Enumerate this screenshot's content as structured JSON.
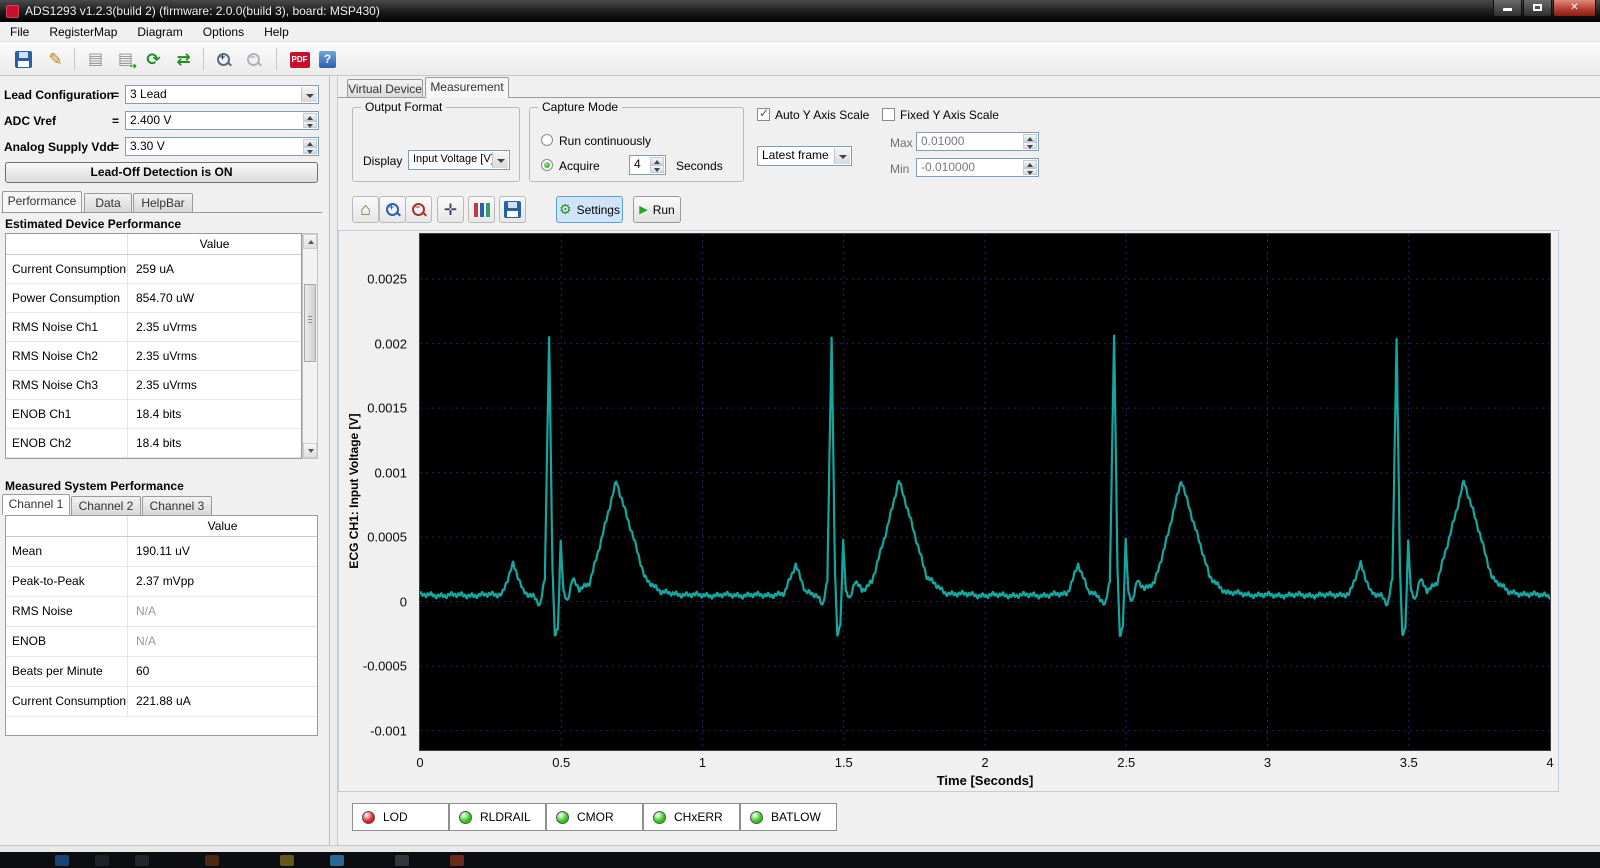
{
  "window": {
    "title": "ADS1293 v1.2.3(build 2) (firmware: 2.0.0(build 3), board: MSP430)",
    "menu": [
      "File",
      "RegisterMap",
      "Diagram",
      "Options",
      "Help"
    ]
  },
  "toolbar": {
    "edit_glyph": "✎",
    "paste_glyph": "▤",
    "import_glyph": "▤",
    "refresh_glyph": "⟳",
    "transfer_glyph": "⇄",
    "pdf_label": "PDF",
    "help_glyph": "?"
  },
  "sidebar": {
    "equals": "=",
    "lead_config_label": "Lead Configuration",
    "lead_config_value": "3 Lead",
    "adc_vref_label": "ADC Vref",
    "adc_vref_value": "2.400 V",
    "vdd_label": "Analog Supply Vdd",
    "vdd_value": "3.30 V",
    "leadoff_button": "Lead-Off Detection is ON",
    "tabs": [
      "Performance",
      "Data",
      "HelpBar"
    ],
    "estimated_title": "Estimated Device Performance",
    "value_header": "Value",
    "estimated_rows": [
      {
        "label": "Current Consumption",
        "value": "259 uA"
      },
      {
        "label": "Power Consumption",
        "value": "854.70 uW"
      },
      {
        "label": "RMS Noise Ch1",
        "value": "2.35 uVrms"
      },
      {
        "label": "RMS Noise Ch2",
        "value": "2.35 uVrms"
      },
      {
        "label": "RMS Noise Ch3",
        "value": "2.35 uVrms"
      },
      {
        "label": "ENOB Ch1",
        "value": "18.4 bits"
      },
      {
        "label": "ENOB Ch2",
        "value": "18.4 bits"
      }
    ],
    "measured_title": "Measured System Performance",
    "channel_tabs": [
      "Channel 1",
      "Channel 2",
      "Channel 3"
    ],
    "measured_rows": [
      {
        "label": "Mean",
        "value": "190.11 uV"
      },
      {
        "label": "Peak-to-Peak",
        "value": "2.37 mVpp"
      },
      {
        "label": "RMS Noise",
        "value": "N/A"
      },
      {
        "label": "ENOB",
        "value": "N/A"
      },
      {
        "label": "Beats per Minute",
        "value": "60"
      },
      {
        "label": "Current Consumption",
        "value": "221.88 uA"
      }
    ]
  },
  "main": {
    "tabs": [
      "Virtual Device",
      "Measurement"
    ],
    "output_format": {
      "title": "Output Format",
      "display_label": "Display",
      "display_value": "Input Voltage [V]"
    },
    "capture_mode": {
      "title": "Capture Mode",
      "run_continuously": "Run continuously",
      "acquire": "Acquire",
      "seconds_value": "4",
      "seconds_label": "Seconds"
    },
    "auto_y": {
      "label": "Auto Y Axis Scale",
      "checked": true,
      "frame_value": "Latest frame"
    },
    "fixed_y": {
      "label": "Fixed Y Axis Scale",
      "checked": false,
      "max_label": "Max",
      "max_value": "0.01000",
      "min_label": "Min",
      "min_value": "-0.010000"
    },
    "plot_buttons": {
      "settings": "Settings",
      "run": "Run"
    },
    "status_leds": [
      {
        "label": "LOD",
        "color": "#e01623"
      },
      {
        "label": "RLDRAIL",
        "color": "#2ec614"
      },
      {
        "label": "CMOR",
        "color": "#2ec614"
      },
      {
        "label": "CHxERR",
        "color": "#2ec614"
      },
      {
        "label": "BATLOW",
        "color": "#2ec614"
      }
    ]
  },
  "chart_data": {
    "type": "line",
    "title": "",
    "series_name": "ECG CH1",
    "xlabel": "Time [Seconds]",
    "ylabel": "ECG CH1: Input Voltage [V]",
    "xlim": [
      0,
      4
    ],
    "ylim": [
      -0.00115,
      0.00285
    ],
    "x_ticks": [
      0,
      0.5,
      1,
      1.5,
      2,
      2.5,
      3,
      3.5,
      4
    ],
    "y_ticks": [
      0.0025,
      0.002,
      0.0015,
      0.001,
      0.0005,
      0,
      -0.0005,
      -0.001
    ],
    "grid": true,
    "legend": false,
    "background": "#000000",
    "grid_color": "#232370",
    "line_color": "#14a7a0",
    "beats_per_minute": 60,
    "r_peak_times": [
      0.47,
      1.47,
      2.47,
      3.47
    ],
    "baseline_v": 5e-05,
    "r_peak_v": 0.00205,
    "t_peak_v": 0.00095,
    "s_dip_v": -0.0003,
    "beat_template": [
      [
        -0.25,
        0
      ],
      [
        -0.18,
        1e-05
      ],
      [
        -0.14,
        0.00024
      ],
      [
        -0.105,
        3e-05
      ],
      [
        -0.065,
        -1e-05
      ],
      [
        -0.045,
        -8e-05
      ],
      [
        -0.028,
        0.00012
      ],
      [
        -0.013,
        0.00201
      ],
      [
        -0.001,
        0.0002
      ],
      [
        0.007,
        -0.00031
      ],
      [
        0.018,
        -0.00025
      ],
      [
        0.028,
        0.00042
      ],
      [
        0.038,
        2e-05
      ],
      [
        0.052,
        -4e-05
      ],
      [
        0.07,
        0.00012
      ],
      [
        0.095,
        4e-05
      ],
      [
        0.13,
        0.0001
      ],
      [
        0.175,
        0.00045
      ],
      [
        0.225,
        0.00089
      ],
      [
        0.275,
        0.00052
      ],
      [
        0.325,
        0.00014
      ],
      [
        0.385,
        2e-05
      ],
      [
        0.5,
        0
      ]
    ]
  }
}
